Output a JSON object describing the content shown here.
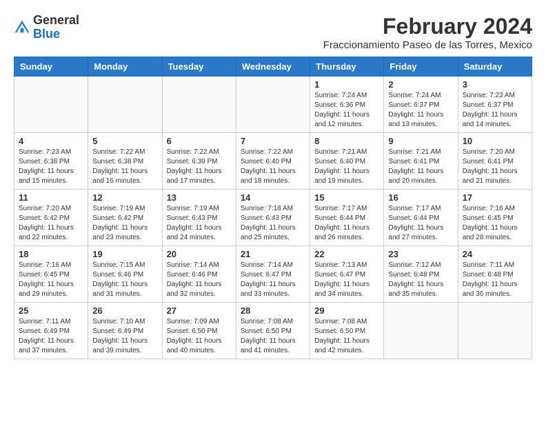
{
  "header": {
    "logo_general": "General",
    "logo_blue": "Blue",
    "month_title": "February 2024",
    "location": "Fraccionamiento Paseo de las Torres, Mexico"
  },
  "days_of_week": [
    "Sunday",
    "Monday",
    "Tuesday",
    "Wednesday",
    "Thursday",
    "Friday",
    "Saturday"
  ],
  "weeks": [
    [
      {
        "day": "",
        "info": ""
      },
      {
        "day": "",
        "info": ""
      },
      {
        "day": "",
        "info": ""
      },
      {
        "day": "",
        "info": ""
      },
      {
        "day": "1",
        "info": "Sunrise: 7:24 AM\nSunset: 6:36 PM\nDaylight: 11 hours\nand 12 minutes."
      },
      {
        "day": "2",
        "info": "Sunrise: 7:24 AM\nSunset: 6:37 PM\nDaylight: 11 hours\nand 13 minutes."
      },
      {
        "day": "3",
        "info": "Sunrise: 7:23 AM\nSunset: 6:37 PM\nDaylight: 11 hours\nand 14 minutes."
      }
    ],
    [
      {
        "day": "4",
        "info": "Sunrise: 7:23 AM\nSunset: 6:38 PM\nDaylight: 11 hours\nand 15 minutes."
      },
      {
        "day": "5",
        "info": "Sunrise: 7:22 AM\nSunset: 6:38 PM\nDaylight: 11 hours\nand 16 minutes."
      },
      {
        "day": "6",
        "info": "Sunrise: 7:22 AM\nSunset: 6:39 PM\nDaylight: 11 hours\nand 17 minutes."
      },
      {
        "day": "7",
        "info": "Sunrise: 7:22 AM\nSunset: 6:40 PM\nDaylight: 11 hours\nand 18 minutes."
      },
      {
        "day": "8",
        "info": "Sunrise: 7:21 AM\nSunset: 6:40 PM\nDaylight: 11 hours\nand 19 minutes."
      },
      {
        "day": "9",
        "info": "Sunrise: 7:21 AM\nSunset: 6:41 PM\nDaylight: 11 hours\nand 20 minutes."
      },
      {
        "day": "10",
        "info": "Sunrise: 7:20 AM\nSunset: 6:41 PM\nDaylight: 11 hours\nand 21 minutes."
      }
    ],
    [
      {
        "day": "11",
        "info": "Sunrise: 7:20 AM\nSunset: 6:42 PM\nDaylight: 11 hours\nand 22 minutes."
      },
      {
        "day": "12",
        "info": "Sunrise: 7:19 AM\nSunset: 6:42 PM\nDaylight: 11 hours\nand 23 minutes."
      },
      {
        "day": "13",
        "info": "Sunrise: 7:19 AM\nSunset: 6:43 PM\nDaylight: 11 hours\nand 24 minutes."
      },
      {
        "day": "14",
        "info": "Sunrise: 7:18 AM\nSunset: 6:43 PM\nDaylight: 11 hours\nand 25 minutes."
      },
      {
        "day": "15",
        "info": "Sunrise: 7:17 AM\nSunset: 6:44 PM\nDaylight: 11 hours\nand 26 minutes."
      },
      {
        "day": "16",
        "info": "Sunrise: 7:17 AM\nSunset: 6:44 PM\nDaylight: 11 hours\nand 27 minutes."
      },
      {
        "day": "17",
        "info": "Sunrise: 7:16 AM\nSunset: 6:45 PM\nDaylight: 11 hours\nand 28 minutes."
      }
    ],
    [
      {
        "day": "18",
        "info": "Sunrise: 7:16 AM\nSunset: 6:45 PM\nDaylight: 11 hours\nand 29 minutes."
      },
      {
        "day": "19",
        "info": "Sunrise: 7:15 AM\nSunset: 6:46 PM\nDaylight: 11 hours\nand 31 minutes."
      },
      {
        "day": "20",
        "info": "Sunrise: 7:14 AM\nSunset: 6:46 PM\nDaylight: 11 hours\nand 32 minutes."
      },
      {
        "day": "21",
        "info": "Sunrise: 7:14 AM\nSunset: 6:47 PM\nDaylight: 11 hours\nand 33 minutes."
      },
      {
        "day": "22",
        "info": "Sunrise: 7:13 AM\nSunset: 6:47 PM\nDaylight: 11 hours\nand 34 minutes."
      },
      {
        "day": "23",
        "info": "Sunrise: 7:12 AM\nSunset: 6:48 PM\nDaylight: 11 hours\nand 35 minutes."
      },
      {
        "day": "24",
        "info": "Sunrise: 7:11 AM\nSunset: 6:48 PM\nDaylight: 11 hours\nand 36 minutes."
      }
    ],
    [
      {
        "day": "25",
        "info": "Sunrise: 7:11 AM\nSunset: 6:49 PM\nDaylight: 11 hours\nand 37 minutes."
      },
      {
        "day": "26",
        "info": "Sunrise: 7:10 AM\nSunset: 6:49 PM\nDaylight: 11 hours\nand 39 minutes."
      },
      {
        "day": "27",
        "info": "Sunrise: 7:09 AM\nSunset: 6:50 PM\nDaylight: 11 hours\nand 40 minutes."
      },
      {
        "day": "28",
        "info": "Sunrise: 7:08 AM\nSunset: 6:50 PM\nDaylight: 11 hours\nand 41 minutes."
      },
      {
        "day": "29",
        "info": "Sunrise: 7:08 AM\nSunset: 6:50 PM\nDaylight: 11 hours\nand 42 minutes."
      },
      {
        "day": "",
        "info": ""
      },
      {
        "day": "",
        "info": ""
      }
    ]
  ]
}
